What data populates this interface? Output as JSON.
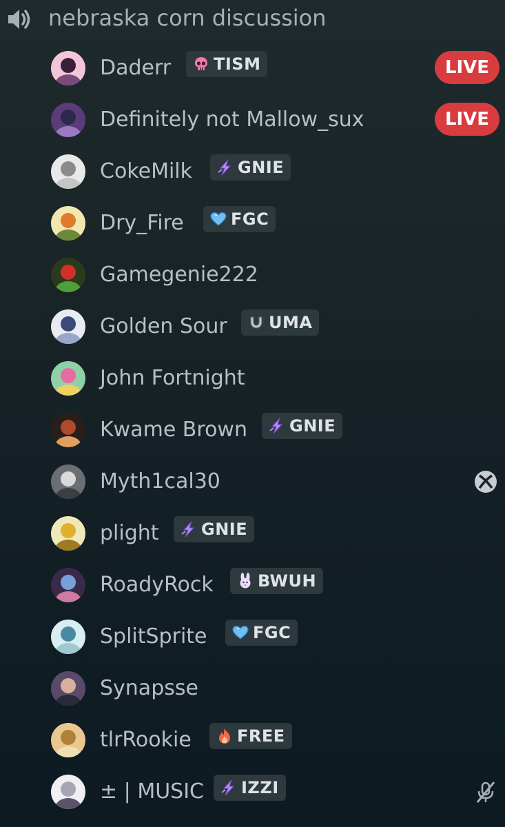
{
  "channel": {
    "name": "nebraska corn discussion",
    "icon": "speaker-icon"
  },
  "colors": {
    "live": "#d83c3e",
    "tag_bg": "#2d393d",
    "name_text": "#b9bfc6"
  },
  "members": [
    {
      "name": "Daderr",
      "tag": {
        "icon": "skull-icon",
        "label": "TISM"
      },
      "live": "LIVE"
    },
    {
      "name": "Definitely not Mallow_sux",
      "live": "LIVE"
    },
    {
      "name": "CokeMilk",
      "tag": {
        "icon": "lightning-icon",
        "label": "GNIE"
      }
    },
    {
      "name": "Dry_Fire",
      "tag": {
        "icon": "heart-icon",
        "label": "FGC"
      }
    },
    {
      "name": "Gamegenie222"
    },
    {
      "name": "Golden Sour",
      "tag": {
        "icon": "horseshoe-icon",
        "label": "UMA"
      }
    },
    {
      "name": "John Fortnight"
    },
    {
      "name": "Kwame Brown",
      "tag": {
        "icon": "lightning-icon",
        "label": "GNIE"
      }
    },
    {
      "name": "Myth1cal30",
      "status_icon": "xbox-icon"
    },
    {
      "name": "plight",
      "tag": {
        "icon": "lightning-icon",
        "label": "GNIE"
      }
    },
    {
      "name": "RoadyRock",
      "tag": {
        "icon": "bunny-icon",
        "label": "BWUH"
      }
    },
    {
      "name": "SplitSprite",
      "tag": {
        "icon": "heart-icon",
        "label": "FGC"
      }
    },
    {
      "name": "Synapsse"
    },
    {
      "name": "tlrRookie",
      "tag": {
        "icon": "flame-icon",
        "label": "FREE"
      }
    },
    {
      "name": "± | MUSIC",
      "tag": {
        "icon": "lightning-icon",
        "label": "IZZI"
      },
      "status_icon": "muted-mic-icon"
    }
  ]
}
